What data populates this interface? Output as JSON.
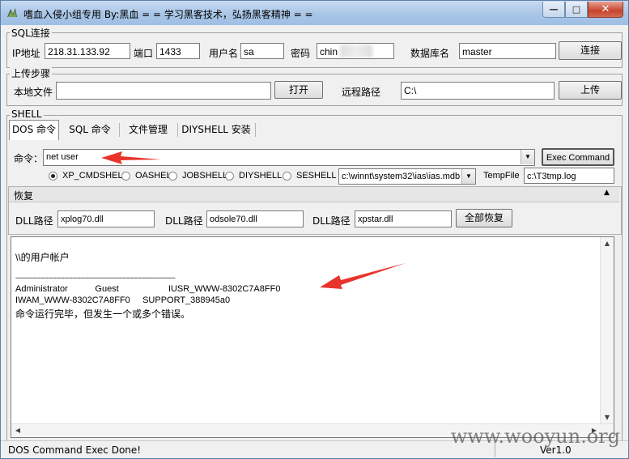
{
  "window": {
    "title": "嗜血入侵小组专用  By:黑血   = = 学习黑客技术，弘扬黑客精神 = =",
    "buttons": {
      "minimize": "—",
      "maximize": "□",
      "close": "✕"
    }
  },
  "sql": {
    "group_label": "SQL连接",
    "ip_label": "IP地址",
    "ip_value": "218.31.133.92",
    "port_label": "端口",
    "port_value": "1433",
    "user_label": "用户名",
    "user_value": "sa",
    "password_label": "密码",
    "password_value": "chin",
    "db_label": "数据库名",
    "db_value": "master",
    "connect_label": "连接"
  },
  "upload": {
    "group_label": "上传步骤",
    "local_label": "本地文件",
    "local_value": "",
    "open_label": "打开",
    "remote_label": "远程路径",
    "remote_value": "C:\\",
    "upload_label": "上传"
  },
  "shell": {
    "group_label": "SHELL",
    "tabs": [
      {
        "label": "DOS 命令",
        "active": true
      },
      {
        "label": "SQL 命令",
        "active": false
      },
      {
        "label": "文件管理",
        "active": false
      },
      {
        "label": "DIYSHELL 安装",
        "active": false
      }
    ],
    "command_label": "命令：",
    "command_value": "net user",
    "exec_label": "Exec Command",
    "radios": [
      {
        "label": "XP_CMDSHELL",
        "selected": true
      },
      {
        "label": "OASHELL",
        "selected": false
      },
      {
        "label": "JOBSHELL",
        "selected": false
      },
      {
        "label": "DIYSHELL",
        "selected": false
      },
      {
        "label": "SESHELL",
        "selected": false
      }
    ],
    "path_value": "c:\\winnt\\system32\\ias\\ias.mdb",
    "tempfile_label": "TempFile",
    "tempfile_value": "c:\\T3tmp.log"
  },
  "restore": {
    "section_label": "恢复",
    "dll1_label": "DLL路径",
    "dll1_value": "xplog70.dll",
    "dll2_label": "DLL路径",
    "dll2_value": "odsole70.dll",
    "dll3_label": "DLL路径",
    "dll3_value": "xpstar.dll",
    "restore_all_label": "全部恢复"
  },
  "output": {
    "lines": [
      "\\\\的用户帐户",
      "-------------------------------------------------------------------------------",
      "Administrator           Guest                    IUSR_WWW-8302C7A8FF0",
      "IWAM_WWW-8302C7A8FF0     SUPPORT_388945a0",
      "命令运行完毕，但发生一个或多个错误。"
    ]
  },
  "status": {
    "message": "DOS Command Exec Done!",
    "version": "Ver1.0"
  },
  "watermark": "www.wooyun.org",
  "colors": {
    "annotation_arrow": "#e8342c",
    "title_gradient": "#a9c5e6"
  }
}
